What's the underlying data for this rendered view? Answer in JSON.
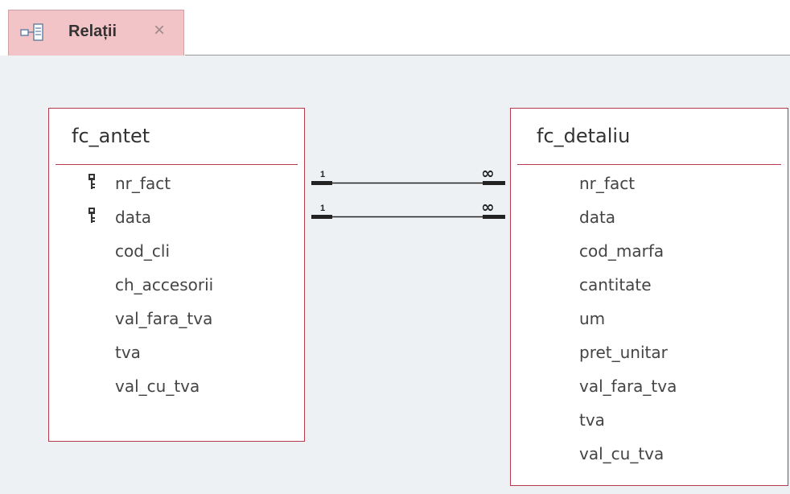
{
  "tab": {
    "title": "Relații",
    "icon": "relationships-icon",
    "close_icon": "close-icon",
    "active_color": "#f3c4c7"
  },
  "tables": {
    "left": {
      "name": "fc_antet",
      "fields": [
        "nr_fact",
        "data",
        "cod_cli",
        "ch_accesorii",
        "val_fara_tva",
        "tva",
        "val_cu_tva"
      ],
      "key_fields": [
        "nr_fact",
        "data"
      ]
    },
    "right": {
      "name": "fc_detaliu",
      "fields": [
        "nr_fact",
        "data",
        "cod_marfa",
        "cantitate",
        "um",
        "pret_unitar",
        "val_fara_tva",
        "tva",
        "val_cu_tva"
      ]
    }
  },
  "relationships": [
    {
      "from": "fc_antet.nr_fact",
      "to": "fc_detaliu.nr_fact",
      "one_label": "1",
      "many_label": "∞"
    },
    {
      "from": "fc_antet.data",
      "to": "fc_detaliu.data",
      "one_label": "1",
      "many_label": "∞"
    }
  ],
  "colors": {
    "table_border": "#b83a4a",
    "canvas": "#eef1f3"
  }
}
